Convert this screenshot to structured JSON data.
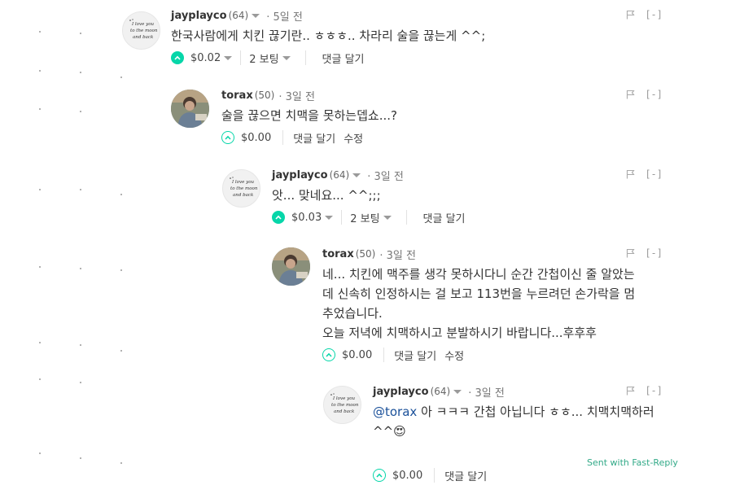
{
  "comments": [
    {
      "author": "jayplayco",
      "rep": "(64)",
      "time": "· 5일 전",
      "text": [
        "한국사람에게 치킨 끊기란.. ㅎㅎㅎ.. 차라리 술을 끊는게 ^^;"
      ],
      "payout": "$0.02",
      "votes": "2 보팅",
      "reply_label": "댓글 달기",
      "edit_label": ""
    },
    {
      "author": "torax",
      "rep": "(50)",
      "time": "· 3일 전",
      "text": [
        "술을 끊으면 치맥을 못하는뎁쇼...?"
      ],
      "payout": "$0.00",
      "votes": "",
      "reply_label": "댓글 달기",
      "edit_label": "수정"
    },
    {
      "author": "jayplayco",
      "rep": "(64)",
      "time": "· 3일 전",
      "text": [
        "앗... 맞네요... ^^;;;"
      ],
      "payout": "$0.03",
      "votes": "2 보팅",
      "reply_label": "댓글 달기",
      "edit_label": ""
    },
    {
      "author": "torax",
      "rep": "(50)",
      "time": "· 3일 전",
      "text": [
        "네... 치킨에 맥주를 생각 못하시다니 순간 간첩이신 줄 알았는",
        "데 신속히 인정하시는 걸 보고 113번을 누르려던 손가락을 멈",
        "추었습니다.",
        "오늘 저녁에 치맥하시고 분발하시기 바랍니다...후후후"
      ],
      "payout": "$0.00",
      "votes": "",
      "reply_label": "댓글 달기",
      "edit_label": "수정"
    },
    {
      "author": "jayplayco",
      "rep": "(64)",
      "time": "· 3일 전",
      "mention": "@torax",
      "text": [
        "아 ㅋㅋㅋ 간첩 아닙니다 ㅎㅎ... 치맥치맥하러",
        "^^😍"
      ],
      "payout": "$0.00",
      "votes": "",
      "reply_label": "댓글 달기",
      "edit_label": "",
      "footer": "Sent with Fast-Reply"
    }
  ],
  "collapse_label": "[-]",
  "flag_icon": "flag-icon",
  "avatar_j_lines": [
    "I love you",
    "to the moon",
    "and back"
  ],
  "colors": {
    "accent": "#06d6a9",
    "mention": "#1a5099",
    "footer": "#33aa88"
  }
}
